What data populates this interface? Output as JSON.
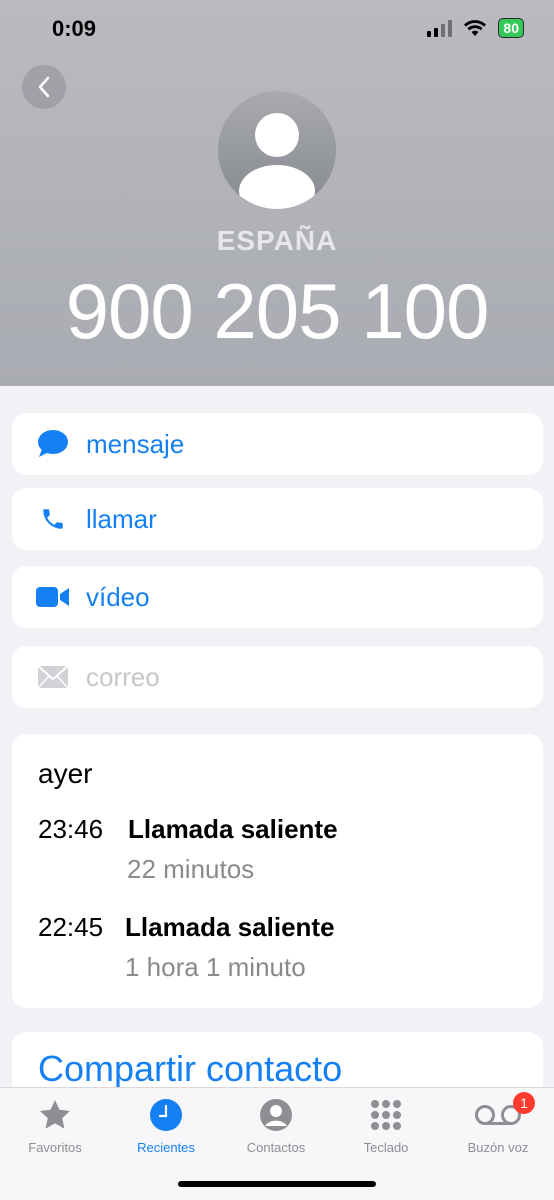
{
  "status_bar": {
    "time": "0:09",
    "battery": "80"
  },
  "contact": {
    "country": "ESPAÑA",
    "number": "900 205 100"
  },
  "actions": [
    {
      "label": "mensaje",
      "icon": "message-bubble-icon",
      "enabled": true
    },
    {
      "label": "llamar",
      "icon": "phone-icon",
      "enabled": true
    },
    {
      "label": "vídeo",
      "icon": "video-camera-icon",
      "enabled": true
    },
    {
      "label": "correo",
      "icon": "envelope-icon",
      "enabled": false
    }
  ],
  "history": {
    "date": "ayer",
    "calls": [
      {
        "time": "23:46",
        "type": "Llamada saliente",
        "duration": "22 minutos"
      },
      {
        "time": "22:45",
        "type": "Llamada saliente",
        "duration": "1 hora 1 minuto"
      }
    ]
  },
  "share": {
    "label": "Compartir contacto"
  },
  "tabs": [
    {
      "label": "Favoritos",
      "icon": "star-icon"
    },
    {
      "label": "Recientes",
      "icon": "clock-icon",
      "active": true
    },
    {
      "label": "Contactos",
      "icon": "person-circle-icon"
    },
    {
      "label": "Teclado",
      "icon": "keypad-icon"
    },
    {
      "label": "Buzón voz",
      "icon": "voicemail-icon",
      "badge": "1"
    }
  ],
  "colors": {
    "accent": "#1580f3",
    "badge": "#ff3b30",
    "battery": "#36c759"
  }
}
